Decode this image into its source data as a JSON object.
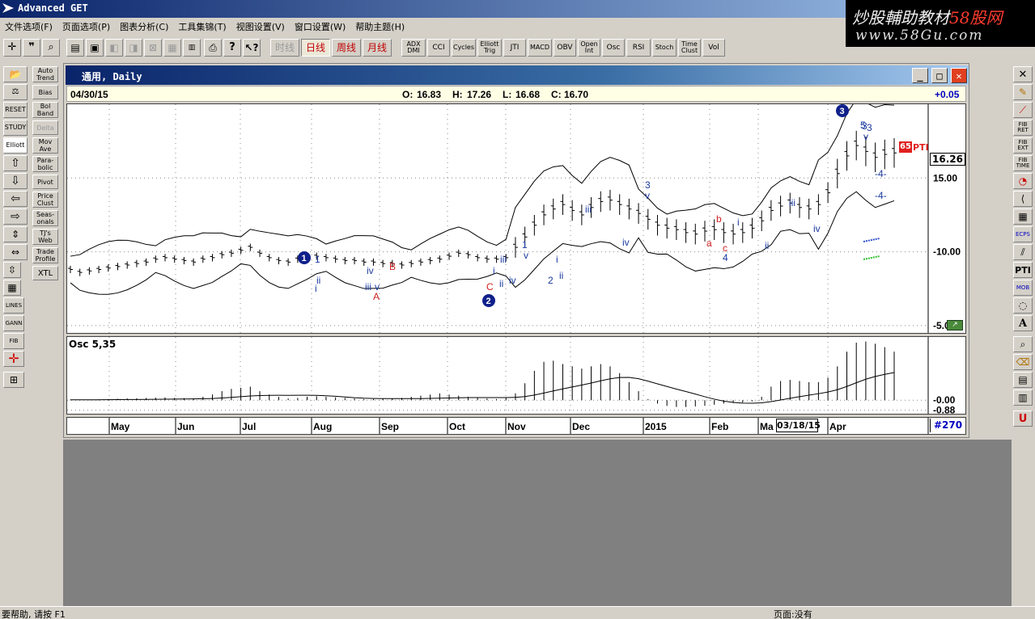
{
  "app": {
    "title": "Advanced GET"
  },
  "watermark": {
    "line1_a": "炒股輔助教材",
    "line1_b": "58股网",
    "line2": "www.58Gu.com"
  },
  "menu": [
    "文件选项(F)",
    "页面选项(P)",
    "图表分析(C)",
    "工具集锦(T)",
    "视图设置(V)",
    "窗口设置(W)",
    "帮助主题(H)"
  ],
  "toolbar": {
    "period_buttons": [
      "时线",
      "日线",
      "周线",
      "月线"
    ],
    "study_buttons": [
      "ADX DMI",
      "CCI",
      "Cycles",
      "Elliott Trig",
      "JTI",
      "MACD",
      "OBV",
      "Open Int",
      "Osc",
      "RSI",
      "Stoch",
      "Time Clust",
      "Vol"
    ]
  },
  "left_toolbar": {
    "col1": [
      "STUDY",
      "Elliott",
      "LINES",
      "GANN",
      "FIB"
    ],
    "col2": [
      "Auto Trend",
      "Bias",
      "Bol Band",
      "Delta",
      "Mov Ave",
      "Para-bolic",
      "Pivot",
      "Price Clust",
      "Seas-onals",
      "TJ's Web",
      "Trade Profile",
      "XTL"
    ]
  },
  "right_toolbar": [
    "FIB RET",
    "FIB EXT",
    "FIB TIME",
    "ECPS",
    "PTI",
    "MOB"
  ],
  "chart_window": {
    "title": "通用, Daily",
    "date": "04/30/15",
    "open_label": "O:",
    "open": "16.83",
    "high_label": "H:",
    "high": "17.26",
    "low_label": "L:",
    "low": "16.68",
    "close_label": "C:",
    "close": "16.70",
    "change": "+0.05",
    "last_price_tag": "16.26",
    "pti_value": "65",
    "pti_label": "PTI",
    "osc_label": "Osc 5,35",
    "cursor_date": "03/18/15",
    "bar_count": "#270"
  },
  "status": {
    "left": "要帮助, 请按 F1",
    "right": "页面:没有"
  },
  "chart_data": {
    "type": "ohlc",
    "price_axis": {
      "ticks": [
        15.0,
        10.0,
        5.0
      ],
      "labels": [
        "15.00",
        "-10.00",
        "-5.0"
      ],
      "range": [
        4.5,
        20.0
      ]
    },
    "osc_axis": {
      "ticks": [
        0.0,
        -0.88
      ],
      "labels": [
        "-0.00",
        "-0.88"
      ]
    },
    "x_ticks": [
      "May",
      "Jun",
      "Jul",
      "Aug",
      "Sep",
      "Oct",
      "Nov",
      "Dec",
      "2015",
      "Feb",
      "Ma",
      "Apr"
    ],
    "close_series": [
      8.8,
      8.6,
      8.7,
      8.8,
      8.9,
      9.0,
      9.1,
      9.2,
      9.3,
      9.5,
      9.6,
      9.5,
      9.4,
      9.3,
      9.5,
      9.6,
      9.8,
      9.9,
      10.1,
      10.3,
      9.9,
      9.6,
      9.4,
      9.3,
      9.5,
      9.6,
      9.7,
      9.6,
      9.5,
      9.4,
      9.4,
      9.3,
      9.3,
      9.2,
      9.2,
      9.1,
      9.2,
      9.3,
      9.4,
      9.5,
      9.7,
      9.9,
      9.8,
      9.6,
      9.5,
      9.5,
      9.6,
      10.3,
      11.0,
      11.8,
      12.5,
      12.9,
      13.2,
      12.8,
      12.5,
      13.0,
      13.4,
      13.5,
      13.2,
      12.9,
      12.6,
      12.2,
      11.8,
      11.6,
      11.5,
      11.3,
      11.2,
      11.4,
      11.5,
      11.3,
      11.2,
      11.3,
      11.6,
      12.1,
      12.8,
      13.1,
      13.3,
      13.0,
      12.9,
      13.2,
      14.0,
      15.3,
      16.5,
      17.2,
      16.8,
      16.4,
      16.6,
      16.7
    ],
    "osc_series": [
      0.05,
      0.04,
      0.05,
      0.07,
      0.1,
      0.12,
      0.15,
      0.17,
      0.2,
      0.22,
      0.25,
      0.2,
      0.18,
      0.15,
      0.3,
      0.5,
      0.8,
      1.0,
      1.1,
      1.2,
      0.8,
      0.5,
      0.3,
      0.15,
      0.2,
      0.3,
      0.35,
      0.3,
      0.25,
      0.2,
      0.15,
      0.1,
      0.1,
      0.12,
      0.15,
      0.2,
      0.3,
      0.4,
      0.5,
      0.6,
      0.5,
      0.4,
      0.3,
      0.2,
      0.15,
      0.1,
      0.2,
      0.6,
      1.5,
      2.6,
      3.4,
      3.5,
      3.2,
      3.0,
      2.8,
      3.0,
      3.2,
      3.0,
      2.4,
      1.6,
      0.8,
      0.1,
      -0.3,
      -0.5,
      -0.6,
      -0.6,
      -0.55,
      -0.5,
      -0.4,
      -0.3,
      -0.25,
      -0.2,
      -0.1,
      0.3,
      1.2,
      1.7,
      1.8,
      1.7,
      1.6,
      1.6,
      2.0,
      3.0,
      4.3,
      5.1,
      5.2,
      5.0,
      4.7,
      4.3
    ],
    "elliott_labels": [
      "1",
      "ii",
      "i",
      "iv",
      "iii",
      "v",
      "B",
      "A",
      "C",
      "iii",
      "i",
      "ii",
      "iv",
      "1",
      "v",
      "2",
      "i",
      "ii",
      "iii",
      "3",
      "v",
      "iv",
      "b",
      "a",
      "c",
      "4",
      "i",
      "ii",
      "iii",
      "iv",
      "3",
      "5",
      "3",
      "v",
      "-4-",
      "-4-"
    ],
    "elliott_circled": [
      "1",
      "2",
      "3"
    ]
  }
}
